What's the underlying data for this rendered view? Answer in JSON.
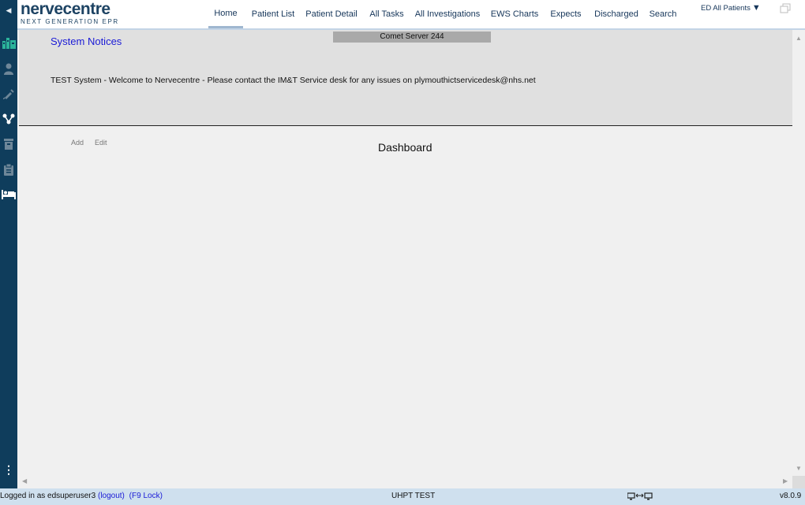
{
  "app": {
    "logo_main": "nervecentre",
    "logo_sub": "NEXT GENERATION EPR"
  },
  "nav": {
    "items": [
      {
        "label": "Home",
        "active": true
      },
      {
        "label": "Patient List"
      },
      {
        "label": "Patient Detail"
      },
      {
        "label": "All Tasks"
      },
      {
        "label": "All Investigations"
      },
      {
        "label": "EWS Charts"
      },
      {
        "label": "Expects"
      },
      {
        "label": "Discharged"
      },
      {
        "label": "Search"
      }
    ],
    "ward_selector": "ED All Patients",
    "ward_caret": "▼"
  },
  "sidebar": {
    "collapse_glyph": "◀",
    "icons": [
      "dashboard-icon",
      "clinician-icon",
      "syringe-icon",
      "network-icon",
      "archive-icon",
      "clipboard-icon",
      "bed-icon"
    ],
    "more_glyph": "⋮"
  },
  "notices": {
    "title": "System Notices",
    "server": "Comet Server 244",
    "message": "TEST System - Welcome to Nervecentre - Please contact the IM&T Service desk for any issues on plymouthictservicedesk@nhs.net"
  },
  "dashboard": {
    "add_label": "Add",
    "edit_label": "Edit",
    "title": "Dashboard"
  },
  "status": {
    "logged_in": "Logged in as edsuperuser3",
    "logout": "(logout)",
    "lock": "(F9 Lock)",
    "environment": "UHPT TEST",
    "version": "v8.0.9"
  },
  "colors": {
    "sidebar_bg": "#0f3d5c",
    "accent_teal": "#2bb39a",
    "link_blue": "#1a1ad6",
    "statusbar_bg": "#cfe0ee"
  }
}
